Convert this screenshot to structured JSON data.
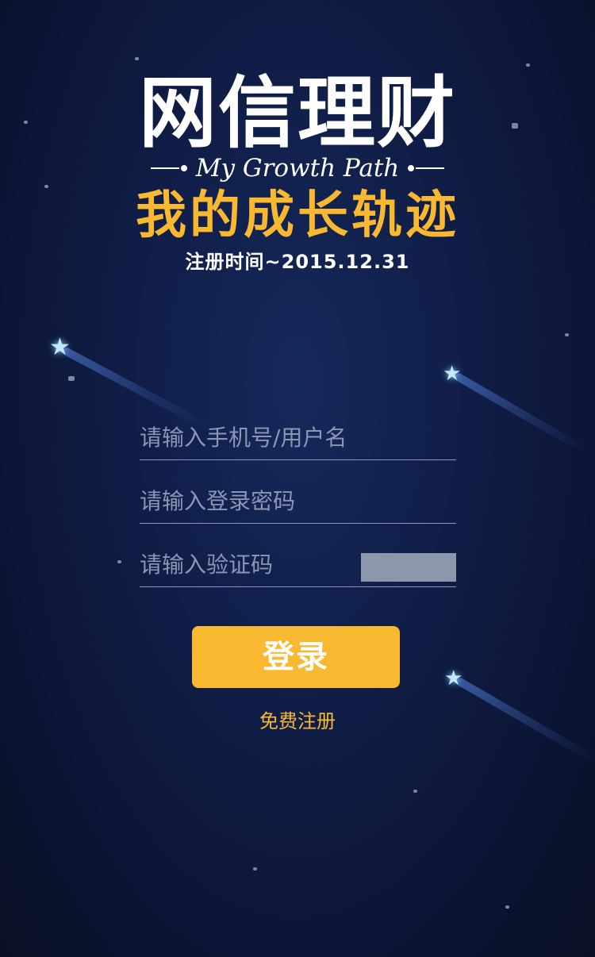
{
  "header": {
    "title": "网信理财",
    "subtitle": "My Growth Path",
    "tagline": "我的成长轨迹",
    "registration_date": "注册时间~2015.12.31"
  },
  "form": {
    "username_placeholder": "请输入手机号/用户名",
    "password_placeholder": "请输入登录密码",
    "captcha_placeholder": "请输入验证码"
  },
  "actions": {
    "login_label": "登录",
    "register_label": "免费注册"
  },
  "colors": {
    "accent": "#f8b830",
    "background": "#0f1c44",
    "captcha_box": "#8d97ab"
  },
  "icons": [
    "star-icon"
  ]
}
